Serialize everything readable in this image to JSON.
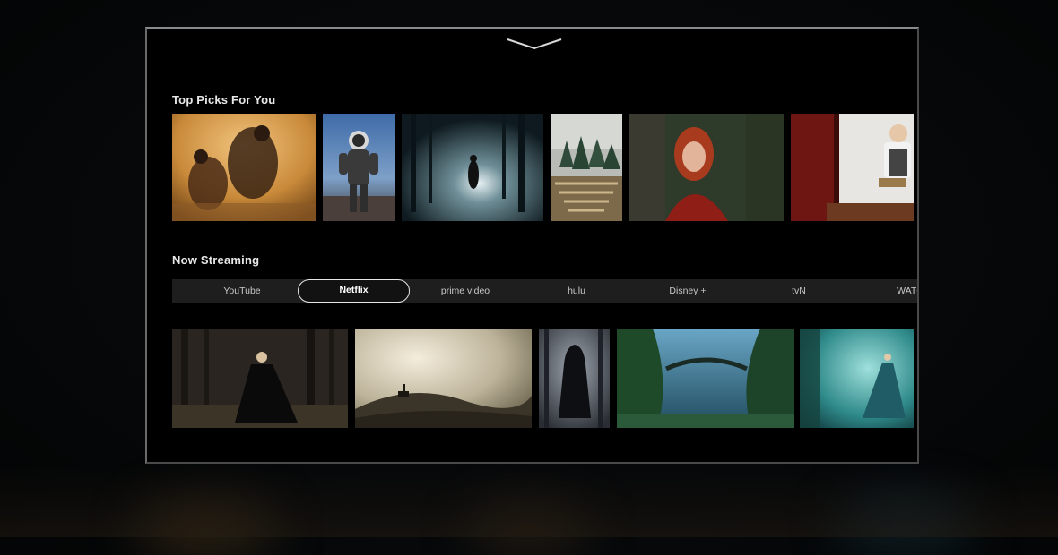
{
  "sections": {
    "top_picks": {
      "title": "Top Picks For You",
      "tiles": [
        {
          "icon": "desert-travelers-poster"
        },
        {
          "icon": "astronaut-poster"
        },
        {
          "icon": "foggy-forest-headlights-poster"
        },
        {
          "icon": "hedge-maze-poster"
        },
        {
          "icon": "red-hood-girl-poster"
        },
        {
          "icon": "reading-girl-poster"
        }
      ]
    },
    "now_streaming": {
      "title": "Now Streaming",
      "tabs": [
        {
          "label": "YouTube"
        },
        {
          "label": "Netflix",
          "active": true
        },
        {
          "label": "prime video"
        },
        {
          "label": "hulu"
        },
        {
          "label": "Disney +"
        },
        {
          "label": "tvN"
        },
        {
          "label": "WATC"
        }
      ],
      "tiles": [
        {
          "icon": "dark-forest-gown-poster"
        },
        {
          "icon": "horseman-hill-poster"
        },
        {
          "icon": "hooded-figure-poster"
        },
        {
          "icon": "jungle-bridge-poster"
        },
        {
          "icon": "blue-mist-lady-poster"
        }
      ]
    }
  },
  "colors": {
    "background": "#05070a",
    "tab_bar": "#1e1e1e",
    "active_outline": "#e6e6e6",
    "title_text": "#e8e8e8"
  }
}
